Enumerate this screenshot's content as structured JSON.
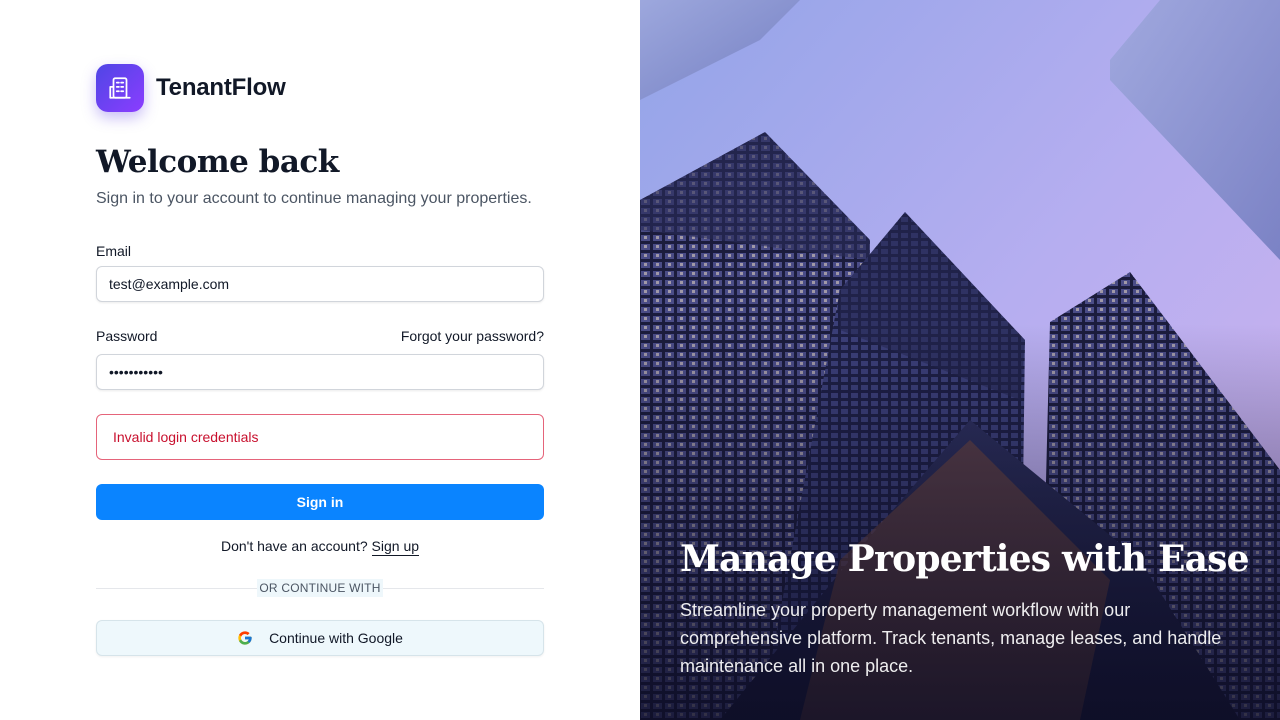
{
  "brand": {
    "name": "TenantFlow",
    "logo_icon": "building-icon",
    "accent_color": "#7c3aed"
  },
  "heading": {
    "title": "Welcome back",
    "subtitle": "Sign in to your account to continue managing your properties."
  },
  "form": {
    "email_label": "Email",
    "email_value": "test@example.com",
    "password_label": "Password",
    "password_value": "•••••••••••",
    "forgot_link": "Forgot your password?",
    "error_message": "Invalid login credentials",
    "error_color": "#c8102e",
    "submit_label": "Sign in",
    "submit_color": "#0a84ff",
    "signup_prompt": "Don't have an account?",
    "signup_link": "Sign up",
    "divider_text": "OR CONTINUE WITH",
    "google_label": "Continue with Google",
    "google_icon": "google-icon"
  },
  "hero": {
    "title": "Manage Properties with Ease",
    "text": "Streamline your property management workflow with our comprehensive platform. Track tenants, manage leases, and handle maintenance all in one place."
  }
}
